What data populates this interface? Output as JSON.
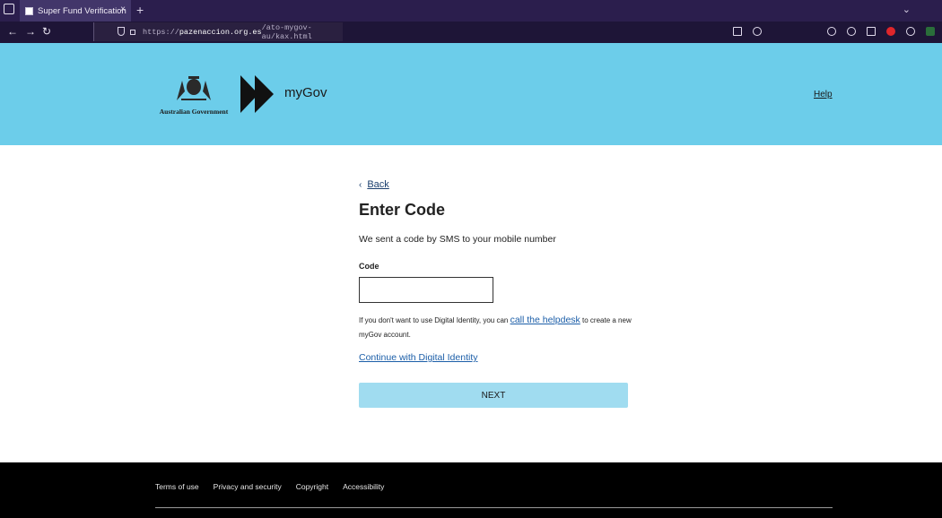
{
  "browser": {
    "tab_title": "Super Fund Verification",
    "tab_close": "×",
    "new_tab": "+",
    "url_prefix": "https://",
    "url_domain": "pazenaccion.org.es",
    "url_path": "/ato-mygov-au/kax.html"
  },
  "header": {
    "gov_name": "Australian Government",
    "brand": "myGov",
    "help_label": "Help"
  },
  "main": {
    "back_label": "Back",
    "heading": "Enter Code",
    "intro": "We sent a code by SMS to your mobile number",
    "code_label": "Code",
    "code_value": "",
    "help_text_before": "If you don't want to use Digital Identity, you can ",
    "helpdesk_link": "call the helpdesk",
    "help_text_after": " to create a new myGov account.",
    "continue_link": "Continue with Digital Identity",
    "next_label": "NEXT"
  },
  "footer": {
    "links": [
      "Terms of use",
      "Privacy and security",
      "Copyright",
      "Accessibility"
    ]
  },
  "colors": {
    "header_bg": "#6ccdea",
    "next_button_bg": "#a0dcf0",
    "link": "#1b5ea8",
    "footer_bg": "#000000",
    "browser_chrome": "#2b1e4d"
  }
}
